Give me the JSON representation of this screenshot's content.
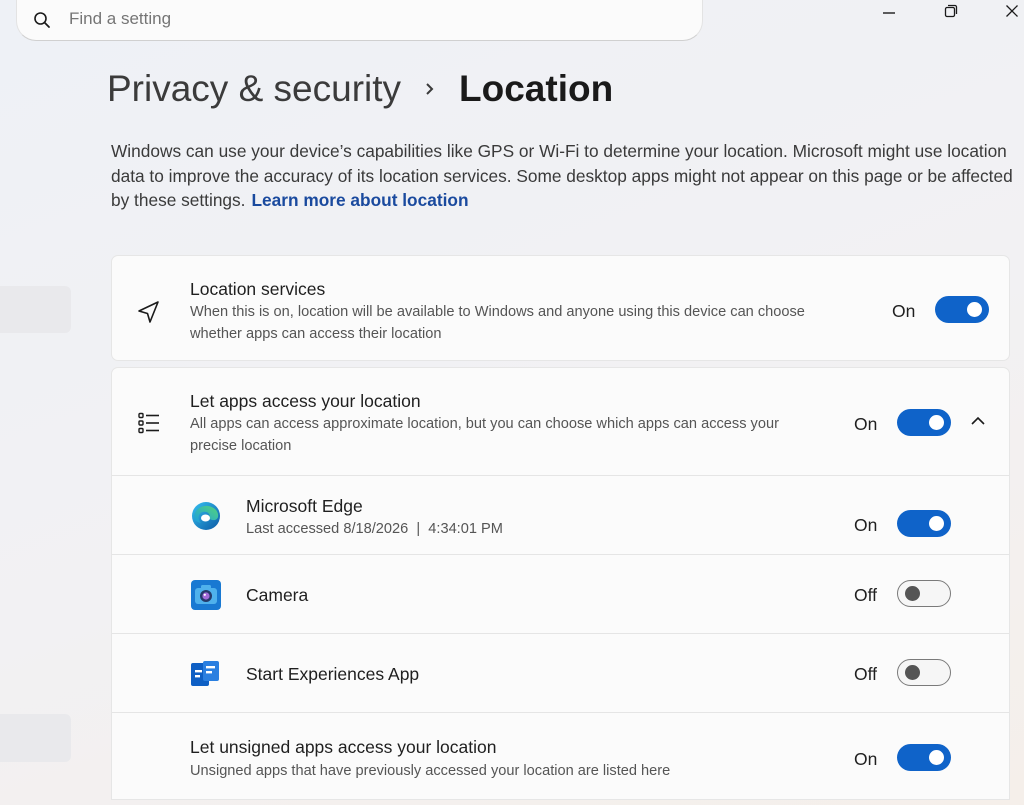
{
  "search": {
    "placeholder": "Find a setting"
  },
  "breadcrumb": {
    "parent": "Privacy & security",
    "current": "Location"
  },
  "description": {
    "text": "Windows can use your device’s capabilities like GPS or Wi-Fi to determine your location. Microsoft might use location data to improve the accuracy of its location services. Some desktop apps might not appear on this page or be affected by these settings.",
    "link": "Learn more about location"
  },
  "location_services": {
    "title": "Location services",
    "subtitle": "When this is on, location will be available to Windows and anyone using this device can choose whether apps can access their location",
    "state": "On",
    "icon": "navigation-arrow-icon"
  },
  "let_apps": {
    "title": "Let apps access your location",
    "subtitle": "All apps can access approximate location, but you can choose which apps can access your precise location",
    "state": "On",
    "icon": "list-icon",
    "expanded": true
  },
  "apps": [
    {
      "name": "Microsoft Edge",
      "detail": "Last accessed 8/18/2026  |  4:34:01 PM",
      "state": "On",
      "icon": "edge-icon"
    },
    {
      "name": "Camera",
      "state": "Off",
      "icon": "camera-icon"
    },
    {
      "name": "Start Experiences App",
      "state": "Off",
      "icon": "start-experiences-icon"
    }
  ],
  "unsigned": {
    "title": "Let unsigned apps access your location",
    "subtitle": "Unsigned apps that have previously accessed your location are listed here",
    "state": "On"
  },
  "colors": {
    "accent": "#0f63c9",
    "link": "#1a4a9e"
  }
}
